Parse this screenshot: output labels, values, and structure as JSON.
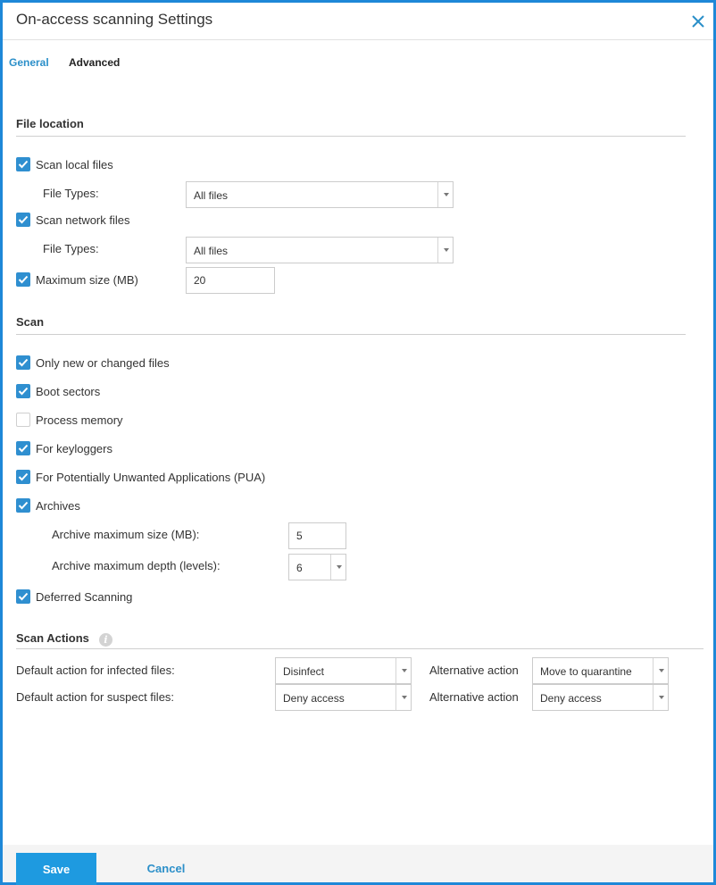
{
  "dialog": {
    "title": "On-access scanning Settings",
    "close_icon": "close-icon",
    "accent_color": "#1e88d8"
  },
  "tabs": [
    {
      "label": "General",
      "active": true
    },
    {
      "label": "Advanced",
      "active": false
    }
  ],
  "file_location": {
    "title": "File location",
    "scan_local_files": {
      "label": "Scan local files",
      "checked": true
    },
    "local_file_types": {
      "label": "File Types:",
      "value": "All files"
    },
    "scan_network_files": {
      "label": "Scan network files",
      "checked": true
    },
    "network_file_types": {
      "label": "File Types:",
      "value": "All files"
    },
    "maximum_size": {
      "label": "Maximum size (MB)",
      "checked": true,
      "value": "20"
    }
  },
  "scan": {
    "title": "Scan",
    "options": [
      {
        "label": "Only new or changed files",
        "checked": true
      },
      {
        "label": "Boot sectors",
        "checked": true
      },
      {
        "label": "Process memory",
        "checked": false
      },
      {
        "label": "For keyloggers",
        "checked": true
      },
      {
        "label": "For Potentially Unwanted Applications (PUA)",
        "checked": true
      },
      {
        "label": "Archives",
        "checked": true
      }
    ],
    "archive_max_size": {
      "label": "Archive maximum size (MB):",
      "value": "5"
    },
    "archive_max_depth": {
      "label": "Archive maximum depth (levels):",
      "value": "6"
    },
    "deferred_scanning": {
      "label": "Deferred Scanning",
      "checked": true
    }
  },
  "scan_actions": {
    "title": "Scan Actions",
    "info_icon": "info-icon",
    "info_glyph": "i",
    "infected": {
      "label": "Default action for infected files:",
      "value": "Disinfect",
      "alt_label": "Alternative action",
      "alt_value": "Move to quarantine"
    },
    "suspect": {
      "label": "Default action for suspect files:",
      "value": "Deny access",
      "alt_label": "Alternative action",
      "alt_value": "Deny access"
    }
  },
  "footer": {
    "save_label": "Save",
    "cancel_label": "Cancel"
  }
}
